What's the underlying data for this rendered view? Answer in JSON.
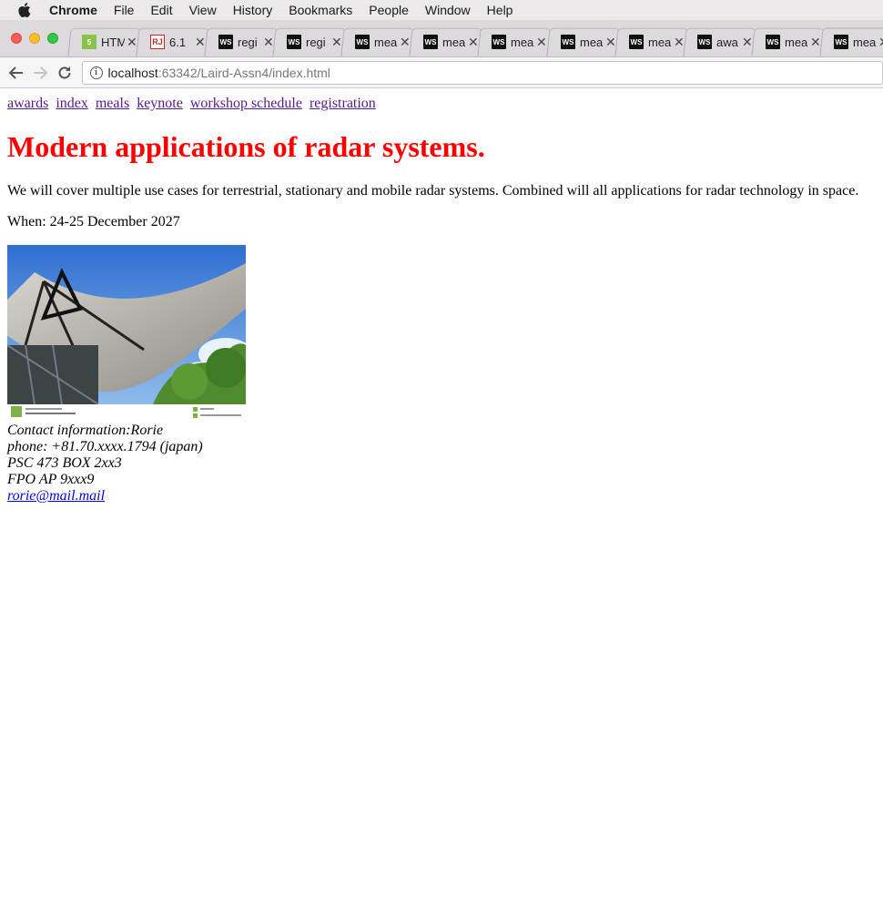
{
  "menubar": {
    "app_name": "Chrome",
    "items": [
      "File",
      "Edit",
      "View",
      "History",
      "Bookmarks",
      "People",
      "Window",
      "Help"
    ]
  },
  "tabs": [
    {
      "title": "HTM",
      "favicon": "html5-icon"
    },
    {
      "title": "6.1",
      "favicon": "ru-icon"
    },
    {
      "title": "regi",
      "favicon": "webstorm-icon"
    },
    {
      "title": "regi",
      "favicon": "webstorm-icon"
    },
    {
      "title": "mea",
      "favicon": "webstorm-icon"
    },
    {
      "title": "mea",
      "favicon": "webstorm-icon"
    },
    {
      "title": "mea",
      "favicon": "webstorm-icon"
    },
    {
      "title": "mea",
      "favicon": "webstorm-icon"
    },
    {
      "title": "mea",
      "favicon": "webstorm-icon"
    },
    {
      "title": "awa",
      "favicon": "webstorm-icon"
    },
    {
      "title": "mea",
      "favicon": "webstorm-icon"
    },
    {
      "title": "mea",
      "favicon": "webstorm-icon"
    }
  ],
  "address": {
    "host": "localhost",
    "path": ":63342/Laird-Assn4/index.html"
  },
  "page": {
    "nav_links": [
      "awards",
      "index",
      "meals",
      "keynote",
      "workshop schedule",
      "registration"
    ],
    "heading": "Modern applications of radar systems.",
    "description": "We will cover multiple use cases for terrestrial, stationary and mobile radar systems. Combined will all applications for radar technology in space.",
    "when": "When: 24-25 December 2027",
    "contact": {
      "line1": "Contact information:Rorie",
      "line2": "phone: +81.70.xxxx.1794 (japan)",
      "line3": "PSC 473 BOX 2xx3",
      "line4": "FPO AP 9xxx9",
      "email": "rorie@mail.mail"
    }
  },
  "colors": {
    "heading": "#ff0000",
    "visited_link": "#551a8b",
    "link": "#0000ee"
  }
}
